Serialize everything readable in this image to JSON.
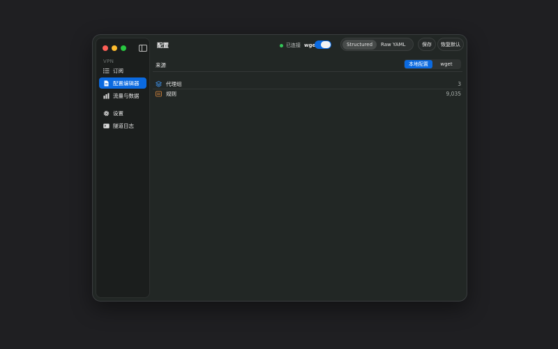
{
  "sidebar": {
    "section_label": "VPN",
    "items": [
      {
        "label": "订阅",
        "icon": "list-icon"
      },
      {
        "label": "配置编辑器",
        "icon": "document-icon",
        "active": true
      },
      {
        "label": "流量与数据",
        "icon": "bar-chart-icon"
      },
      {
        "label": "设置",
        "icon": "gear-icon"
      },
      {
        "label": "隧道日志",
        "icon": "terminal-icon"
      }
    ]
  },
  "toolbar": {
    "title": "配置",
    "status_text": "已连接",
    "status_color": "#34c759",
    "profile_name": "wget",
    "mode_structured": "Structured",
    "mode_raw": "Raw YAML",
    "save_label": "保存",
    "restore_label": "恢复默认"
  },
  "source": {
    "label": "来源",
    "option_local": "本地配置",
    "option_remote": "wget"
  },
  "rows": [
    {
      "label": "代理组",
      "value": "3",
      "icon": "stack-icon"
    },
    {
      "label": "规则",
      "value": "9,035",
      "icon": "list-box-icon"
    }
  ],
  "colors": {
    "accent": "#0b6ae0"
  }
}
